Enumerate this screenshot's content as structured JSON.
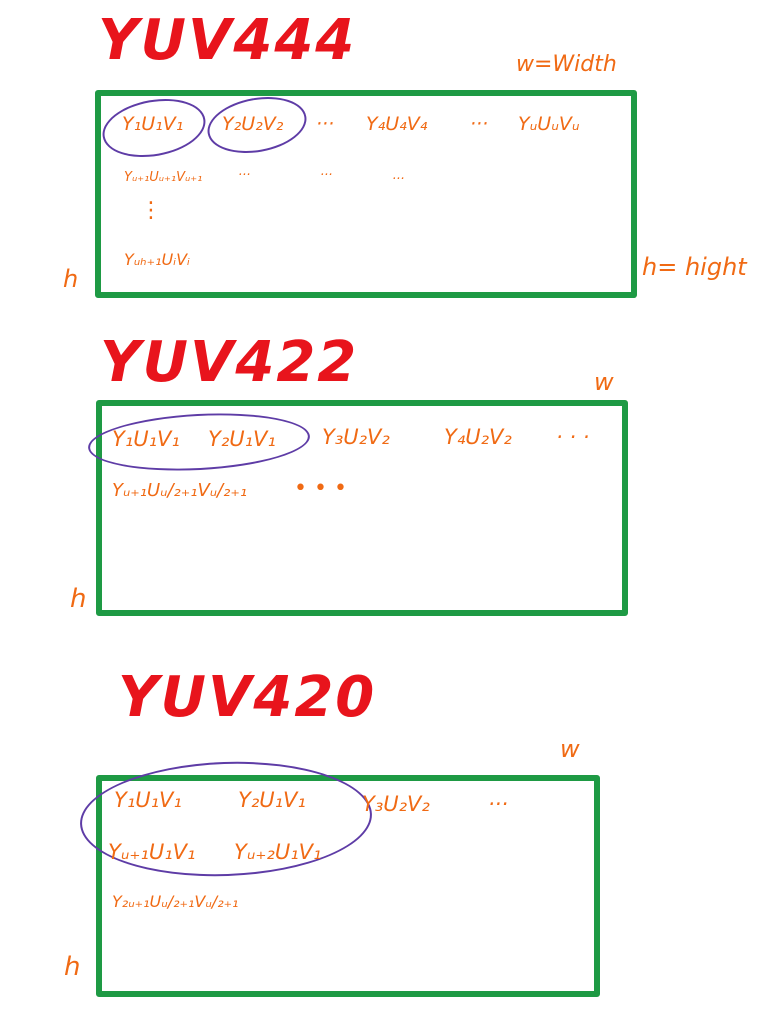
{
  "panels": [
    {
      "title": "YUV444",
      "width_label": "w=Width",
      "height_left": "h",
      "height_right": "h= hight",
      "row1": [
        "Y₁U₁V₁",
        "Y₂U₂V₂",
        "···",
        "Y₄U₄V₄",
        "···",
        "YᵤUᵤVᵤ"
      ],
      "row2": [
        "Yᵤ₊₁Uᵤ₊₁Vᵤ₊₁",
        "···",
        "···",
        "···"
      ],
      "vdots": "⋮",
      "row3": "Yᵤₕ₊₁UᵢVᵢ"
    },
    {
      "title": "YUV422",
      "width_label": "w",
      "height_left": "h",
      "row1": [
        "Y₁U₁V₁",
        "Y₂U₁V₁",
        "Y₃U₂V₂",
        "Y₄U₂V₂",
        "· · ·"
      ],
      "row2": [
        "Yᵤ₊₁Uᵤ/₂₊₁Vᵤ/₂₊₁",
        "• • •"
      ]
    },
    {
      "title": "YUV420",
      "width_label": "w",
      "height_left": "h",
      "row1": [
        "Y₁U₁V₁",
        "Y₂U₁V₁",
        "Y₃U₂V₂",
        "···"
      ],
      "row2": [
        "Yᵤ₊₁U₁V₁",
        "Yᵤ₊₂U₁V₁"
      ],
      "row3": "Y₂ᵤ₊₁Uᵤ/₂₊₁Vᵤ/₂₊₁"
    }
  ],
  "colors": {
    "title": "#e8141c",
    "label": "#f06a14",
    "box": "#1e9a44",
    "oval": "#5e3ca6"
  }
}
